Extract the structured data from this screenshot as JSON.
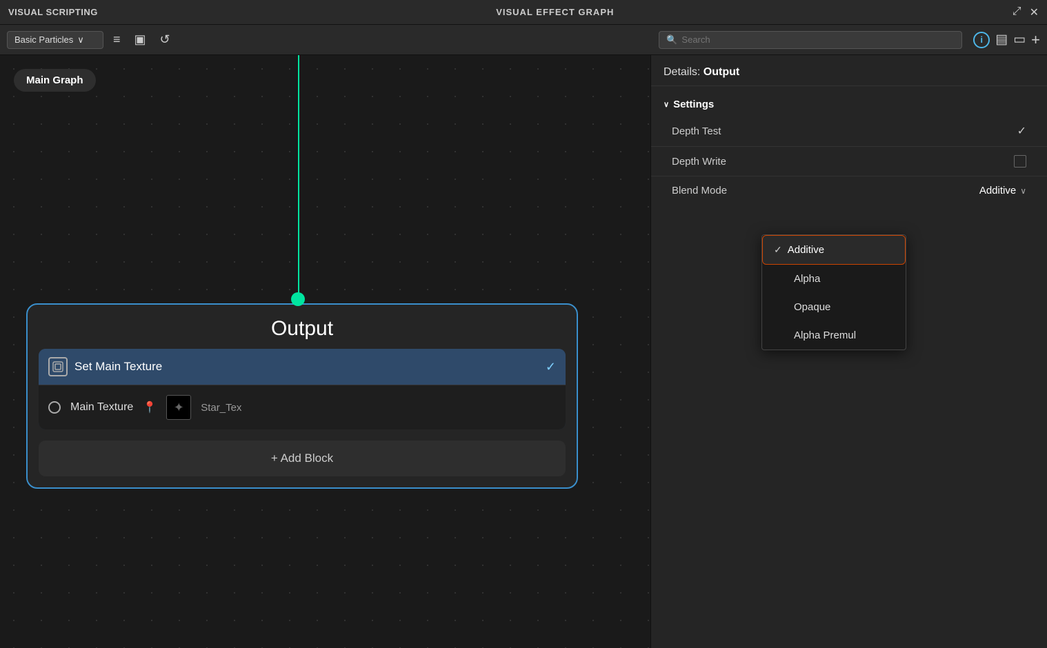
{
  "titleBar": {
    "left": "VISUAL SCRIPTING",
    "center": "VISUAL EFFECT GRAPH",
    "expandIcon": "⤢",
    "closeIcon": "✕"
  },
  "toolbar": {
    "dropdown": "Basic Particles",
    "dropdownChevron": "∨",
    "searchPlaceholder": "Search",
    "icons": {
      "menu": "≡",
      "layout": "▣",
      "refresh": "↺",
      "info": "ⓘ",
      "notes": "▤",
      "file": "▭",
      "add": "+"
    }
  },
  "mainGraph": {
    "label": "Main Graph"
  },
  "outputNode": {
    "title": "Output",
    "blockTitle": "Set Main Texture",
    "mainTextureLabel": "Main Texture",
    "textureName": "Star_Tex",
    "addBlockLabel": "+ Add Block"
  },
  "detailsPanel": {
    "headerLabel": "Details: ",
    "headerValue": "Output",
    "settingsTitle": "Settings",
    "rows": [
      {
        "label": "Depth Test",
        "controlType": "check",
        "checked": true
      },
      {
        "label": "Depth Write",
        "controlType": "checkbox",
        "checked": false
      }
    ],
    "blendMode": {
      "label": "Blend Mode",
      "value": "Additive"
    },
    "dropdown": {
      "items": [
        {
          "label": "Additive",
          "selected": true
        },
        {
          "label": "Alpha",
          "selected": false
        },
        {
          "label": "Opaque",
          "selected": false
        },
        {
          "label": "Alpha Premul",
          "selected": false
        }
      ]
    }
  }
}
